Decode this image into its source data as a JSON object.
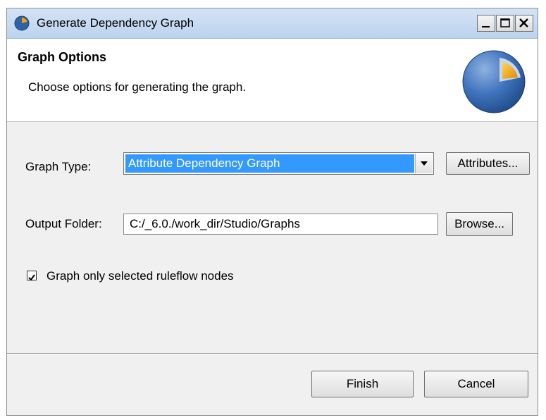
{
  "window": {
    "title": "Generate Dependency Graph",
    "icon": "app-pie-icon",
    "controls": {
      "minimize": "minimize-icon",
      "maximize": "maximize-icon",
      "close": "close-icon"
    }
  },
  "banner": {
    "title": "Graph Options",
    "description": "Choose options for generating the graph.",
    "icon": "pie-chart-wizard-icon"
  },
  "form": {
    "graph_type_label": "Graph Type:",
    "graph_type_value": "Attribute Dependency Graph",
    "attributes_button": "Attributes...",
    "output_folder_label": "Output Folder:",
    "output_folder_value": "C:/_6.0./work_dir/Studio/Graphs",
    "browse_button": "Browse...",
    "checkbox_label": "Graph only selected ruleflow nodes",
    "checkbox_checked": true
  },
  "footer": {
    "finish_button": "Finish",
    "cancel_button": "Cancel"
  },
  "colors": {
    "selection": "#3399ff",
    "titlebar": "#c8dbf2",
    "dialog_bg": "#f0f0f0",
    "icon_blue": "#2e62a8",
    "icon_orange": "#f2a100"
  }
}
